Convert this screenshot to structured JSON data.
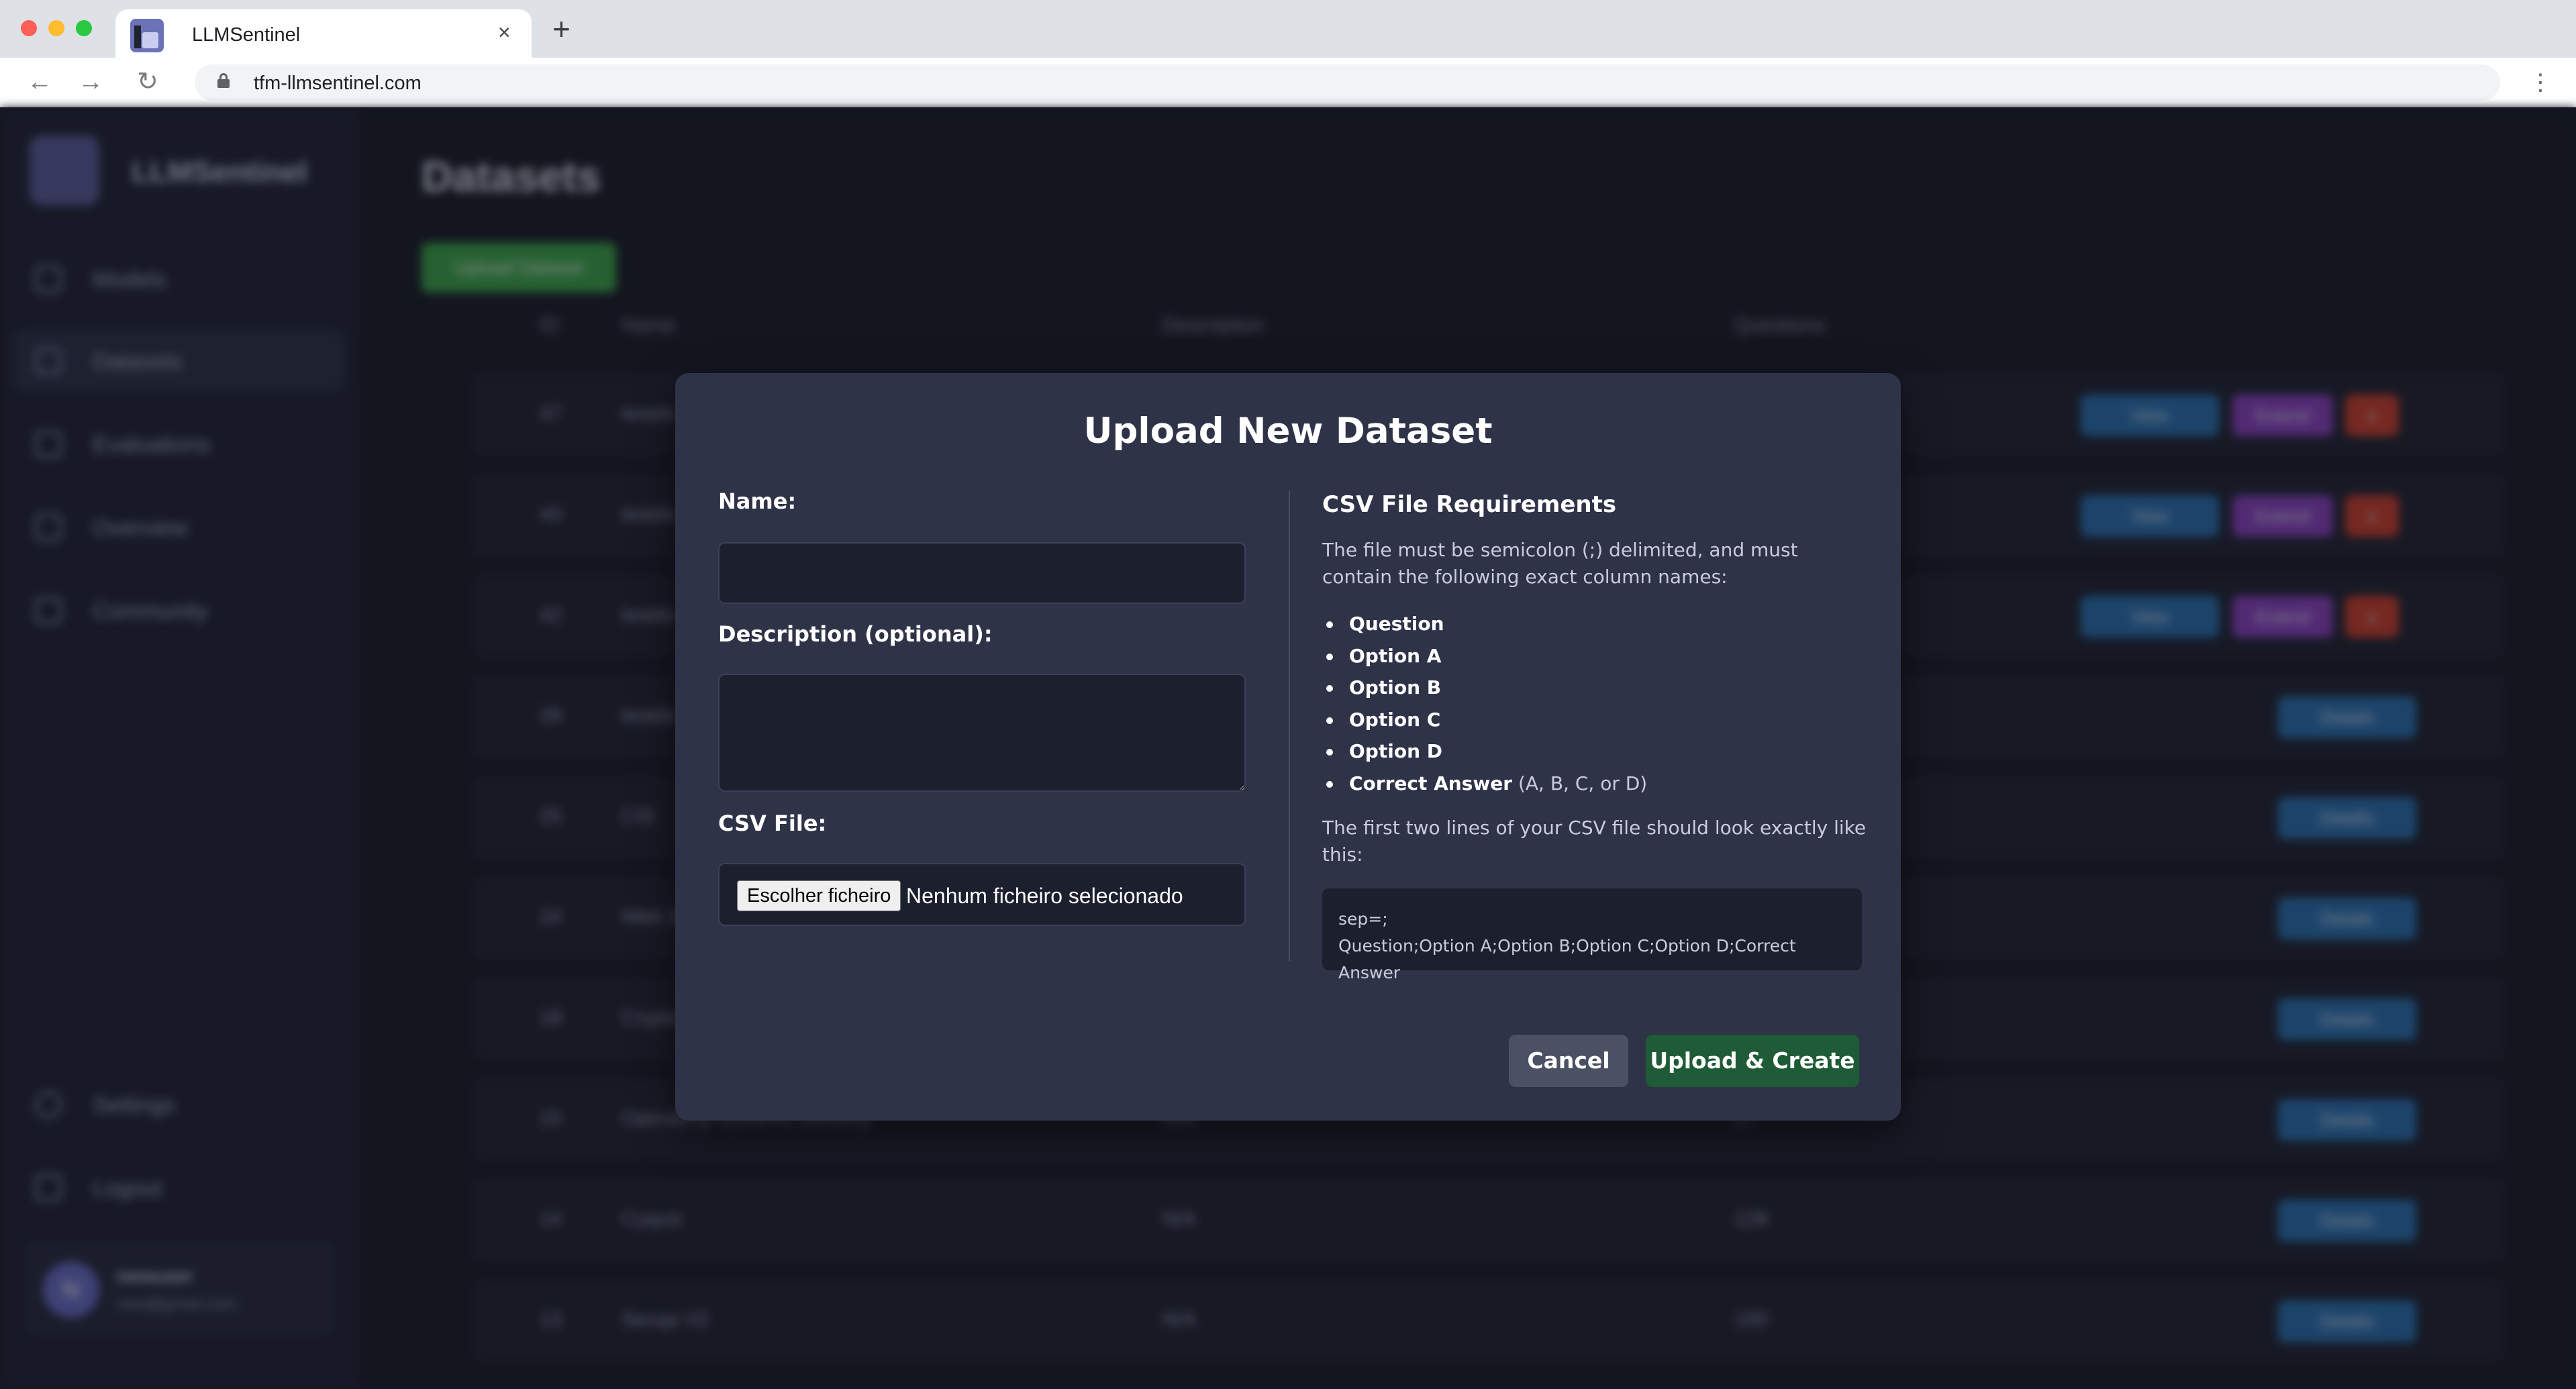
{
  "browser": {
    "tab_title": "LLMSentinel",
    "tab_close": "×",
    "new_tab": "+",
    "url": "tfm-llmsentinel.com",
    "nav_back": "←",
    "nav_forward": "→",
    "nav_reload": "↻",
    "menu": "⋮"
  },
  "app": {
    "brand": "LLMSentinel",
    "sidebar": {
      "items": [
        {
          "label": "Models",
          "icon": "box-icon"
        },
        {
          "label": "Datasets",
          "icon": "folder-icon"
        },
        {
          "label": "Evaluations",
          "icon": "lightbulb-icon"
        },
        {
          "label": "Overview",
          "icon": "clipboard-icon"
        },
        {
          "label": "Community",
          "icon": "bulb-icon"
        }
      ],
      "bottom_items": [
        {
          "label": "Settings",
          "icon": "gear-icon"
        },
        {
          "label": "Logout",
          "icon": "logout-icon"
        }
      ],
      "user": {
        "initial": "N",
        "name": "newuser",
        "email": "new@gmail.com"
      }
    },
    "main": {
      "title": "Datasets",
      "create_button": "Upload Dataset",
      "columns": [
        "ID",
        "Name",
        "Description",
        "Questions"
      ],
      "rows": [
        {
          "id": "47",
          "name": "testds",
          "description": "",
          "questions": "",
          "actions": [
            "View",
            "Extend",
            "x"
          ]
        },
        {
          "id": "43",
          "name": "testds",
          "description": "",
          "questions": "",
          "actions": [
            "View",
            "Extend",
            "x"
          ]
        },
        {
          "id": "42",
          "name": "testds",
          "description": "",
          "questions": "",
          "actions": [
            "View",
            "Extend",
            "x"
          ]
        },
        {
          "id": "29",
          "name": "testds",
          "description": "",
          "questions": "",
          "actions": [
            "Details"
          ]
        },
        {
          "id": "25",
          "name": "CIS",
          "description": "",
          "questions": "",
          "actions": [
            "Details"
          ]
        },
        {
          "id": "24",
          "name": "Web Security",
          "description": "",
          "questions": "",
          "actions": [
            "Details"
          ]
        },
        {
          "id": "18",
          "name": "Cryptography",
          "description": "",
          "questions": "",
          "actions": [
            "Details"
          ]
        },
        {
          "id": "15",
          "name": "Operating Systems Security",
          "description": "N/A",
          "questions": "27",
          "actions": [
            "Details"
          ]
        },
        {
          "id": "14",
          "name": "Cyquiz",
          "description": "N/A",
          "questions": "128",
          "actions": [
            "Details"
          ]
        },
        {
          "id": "13",
          "name": "Secqa V2",
          "description": "N/A",
          "questions": "100",
          "actions": [
            "Details"
          ]
        }
      ]
    }
  },
  "modal": {
    "title": "Upload New Dataset",
    "name_label": "Name:",
    "name_value": "",
    "description_label": "Description (optional):",
    "description_value": "",
    "csv_label": "CSV File:",
    "file_button": "Escolher ficheiro",
    "file_status": "Nenhum ficheiro selecionado",
    "requirements": {
      "title": "CSV File Requirements",
      "intro": "The file must be semicolon (;) delimited, and must contain the following exact column names:",
      "columns": [
        {
          "name": "Question",
          "note": ""
        },
        {
          "name": "Option A",
          "note": ""
        },
        {
          "name": "Option B",
          "note": ""
        },
        {
          "name": "Option C",
          "note": ""
        },
        {
          "name": "Option D",
          "note": ""
        },
        {
          "name": "Correct Answer",
          "note": " (A, B, C, or D)"
        }
      ],
      "example_intro": "The first two lines of your CSV file should look exactly like this:",
      "example_line1": "sep=;",
      "example_line2": "Question;Option A;Option B;Option C;Option D;Correct Answer"
    },
    "cancel_button": "Cancel",
    "submit_button": "Upload & Create"
  },
  "colors": {
    "modal_bg": "#2f3348",
    "submit_green": "#1e5b36",
    "cancel_gray": "#4b5063",
    "page_bg": "#1c1f2b"
  }
}
